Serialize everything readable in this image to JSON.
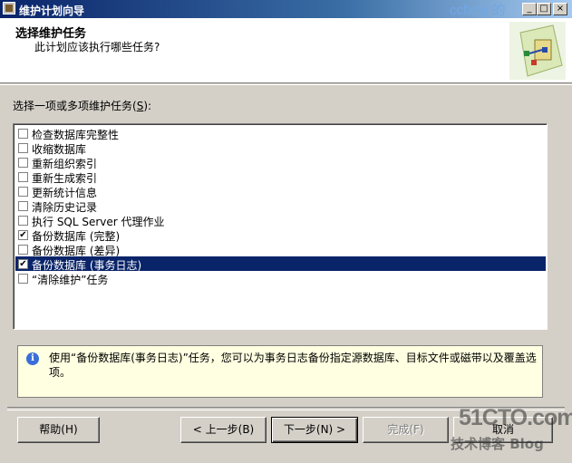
{
  "window": {
    "title": "维护计划向导",
    "watermark": "ccfxny 的",
    "controls": {
      "minimize": "_",
      "maximize": "□",
      "close": "×"
    }
  },
  "header": {
    "title": "选择维护任务",
    "subtitle": "此计划应该执行哪些任务?"
  },
  "list": {
    "label": "选择一项或多项维护任务",
    "mnemonic": "S",
    "label_suffix": "):",
    "items": [
      {
        "label": "检查数据库完整性",
        "checked": false,
        "selected": false
      },
      {
        "label": "收缩数据库",
        "checked": false,
        "selected": false
      },
      {
        "label": "重新组织索引",
        "checked": false,
        "selected": false
      },
      {
        "label": "重新生成索引",
        "checked": false,
        "selected": false
      },
      {
        "label": "更新统计信息",
        "checked": false,
        "selected": false
      },
      {
        "label": "清除历史记录",
        "checked": false,
        "selected": false
      },
      {
        "label": "执行 SQL Server 代理作业",
        "checked": false,
        "selected": false
      },
      {
        "label": "备份数据库 (完整)",
        "checked": true,
        "selected": false
      },
      {
        "label": "备份数据库 (差异)",
        "checked": false,
        "selected": false
      },
      {
        "label": "备份数据库 (事务日志)",
        "checked": true,
        "selected": true
      },
      {
        "label": "“清除维护”任务",
        "checked": false,
        "selected": false
      }
    ]
  },
  "description": {
    "text": "使用“备份数据库(事务日志)”任务，您可以为事务日志备份指定源数据库、目标文件或磁带以及覆盖选项。"
  },
  "buttons": {
    "help": "帮助(H)",
    "back": "< 上一步(B)",
    "next": "下一步(N) >",
    "finish": "完成(F)",
    "cancel": "取消"
  },
  "watermark_bottom": {
    "site": "51CTO.com",
    "blog": "技术博客 Blog"
  },
  "colors": {
    "title_gradient_start": "#0a246a",
    "selection": "#0a246a",
    "face": "#d4d0c8",
    "info_bg": "#ffffe1"
  }
}
